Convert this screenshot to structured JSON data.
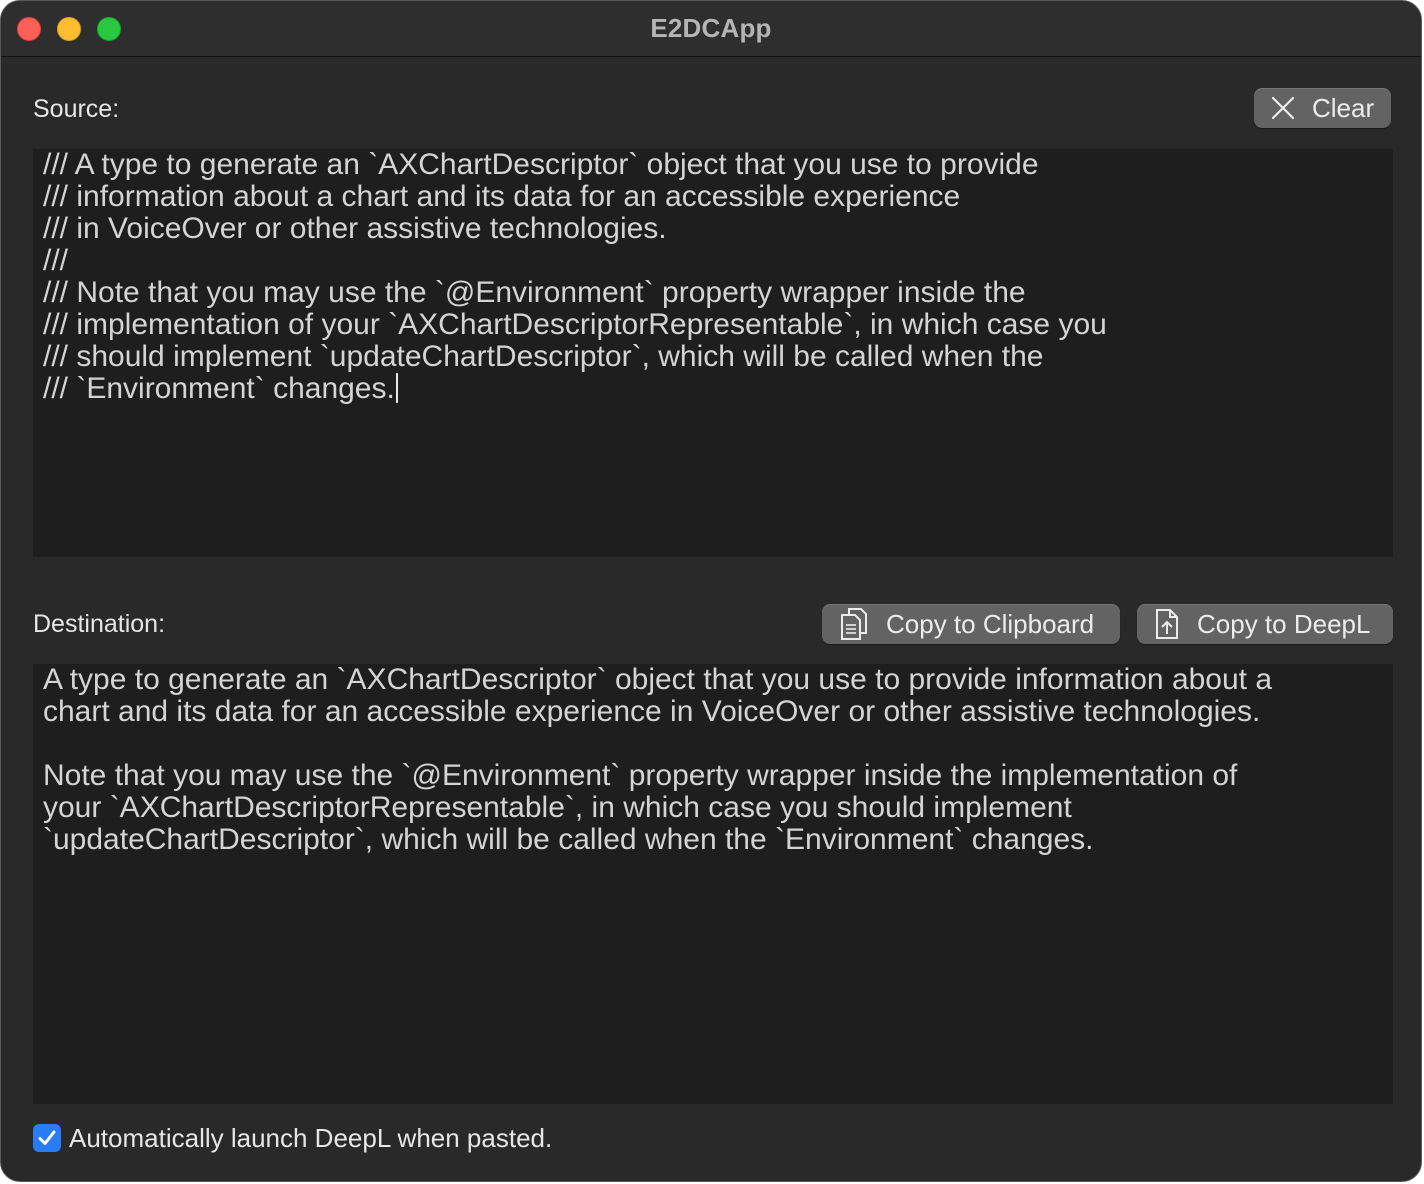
{
  "window": {
    "title": "E2DCApp"
  },
  "source": {
    "label": "Source:",
    "clear_button": "Clear",
    "text": "/// A type to generate an `AXChartDescriptor` object that you use to provide\n/// information about a chart and its data for an accessible experience\n/// in VoiceOver or other assistive technologies.\n///\n/// Note that you may use the `@Environment` property wrapper inside the\n/// implementation of your `AXChartDescriptorRepresentable`, in which case you\n/// should implement `updateChartDescriptor`, which will be called when the\n/// `Environment` changes."
  },
  "destination": {
    "label": "Destination:",
    "copy_clipboard_button": "Copy to Clipboard",
    "copy_deepl_button": "Copy to DeepL",
    "text": "A type to generate an `AXChartDescriptor` object that you use to provide information about a\nchart and its data for an accessible experience in VoiceOver or other assistive technologies.\n\nNote that you may use the `@Environment` property wrapper inside the implementation of\nyour `AXChartDescriptorRepresentable`, in which case you should implement\n`updateChartDescriptor`, which will be called when the `Environment` changes."
  },
  "auto_launch": {
    "label": "Automatically launch DeepL when pasted.",
    "checked": true
  },
  "colors": {
    "window_bg": "#292929",
    "text_area_bg": "#1e1e1e",
    "button_bg": "#636363",
    "checkbox_accent": "#2a7bf6"
  },
  "icons": {
    "clear": "close-x-icon",
    "clipboard": "documents-icon",
    "deepl": "document-upload-icon"
  }
}
